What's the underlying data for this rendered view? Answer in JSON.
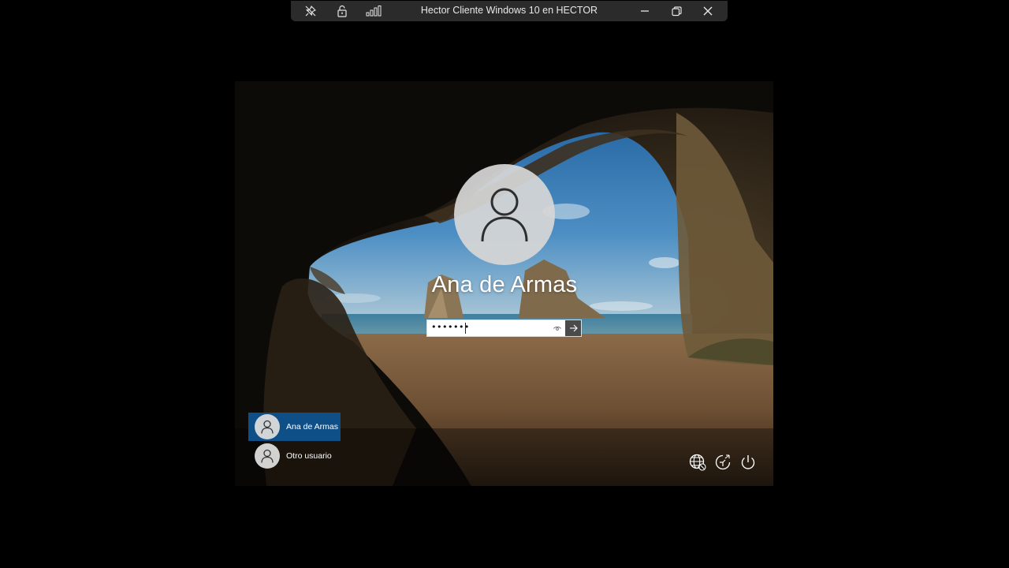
{
  "connection_bar": {
    "title": "Hector Cliente Windows 10 en HECTOR",
    "icons": [
      "unpin-icon",
      "lock-icon",
      "signal-bars-icon",
      "minimize-icon",
      "restore-icon",
      "close-icon"
    ]
  },
  "lock_screen": {
    "current_user": "Ana de Armas",
    "password_masked": "•••••••",
    "users": [
      {
        "label": "Ana de Armas",
        "selected": true
      },
      {
        "label": "Otro usuario",
        "selected": false
      }
    ],
    "system_icons": [
      "network-icon",
      "accessibility-icon",
      "power-icon"
    ]
  },
  "colors": {
    "selected_user": "#0f4f88",
    "connection_bar": "#2b2b2b",
    "submit_button": "#4a4a4a"
  }
}
